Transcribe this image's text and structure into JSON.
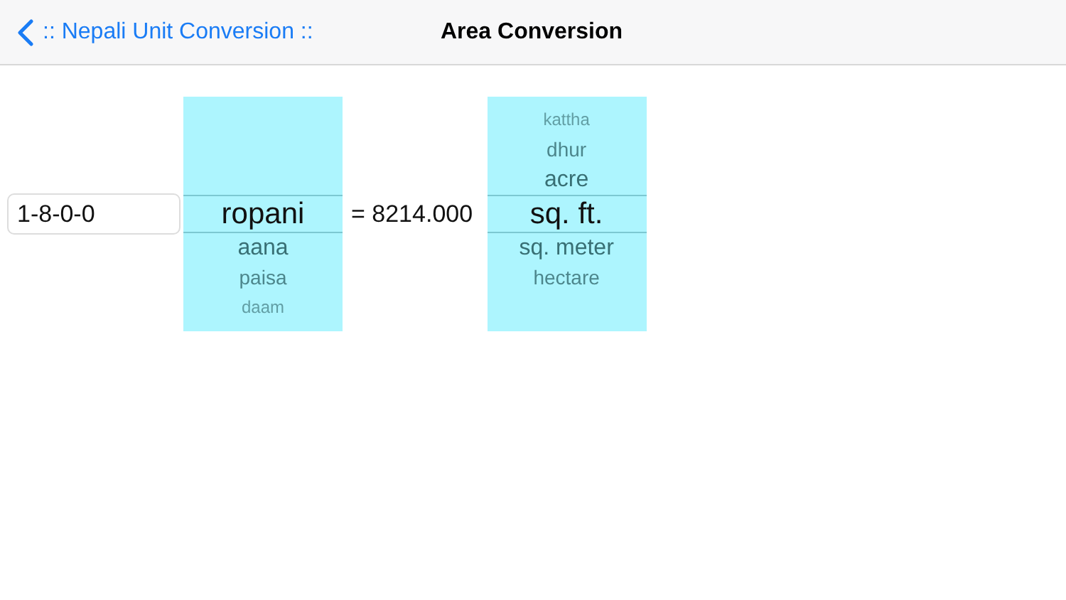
{
  "nav_bar": {
    "back_label": ":: Nepali Unit Conversion ::",
    "title": "Area Conversion"
  },
  "input": {
    "value": "1-8-0-0"
  },
  "from_picker": {
    "items": [
      {
        "label": "ropani",
        "selected": true
      },
      {
        "label": "aana",
        "selected": false
      },
      {
        "label": "paisa",
        "selected": false
      },
      {
        "label": "daam",
        "selected": false
      }
    ]
  },
  "result": "= 8214.000",
  "to_picker": {
    "items": [
      {
        "label": "kattha",
        "selected": false
      },
      {
        "label": "dhur",
        "selected": false
      },
      {
        "label": "acre",
        "selected": false
      },
      {
        "label": "sq. ft.",
        "selected": true
      },
      {
        "label": "sq. meter",
        "selected": false
      },
      {
        "label": "hectare",
        "selected": false
      }
    ]
  }
}
